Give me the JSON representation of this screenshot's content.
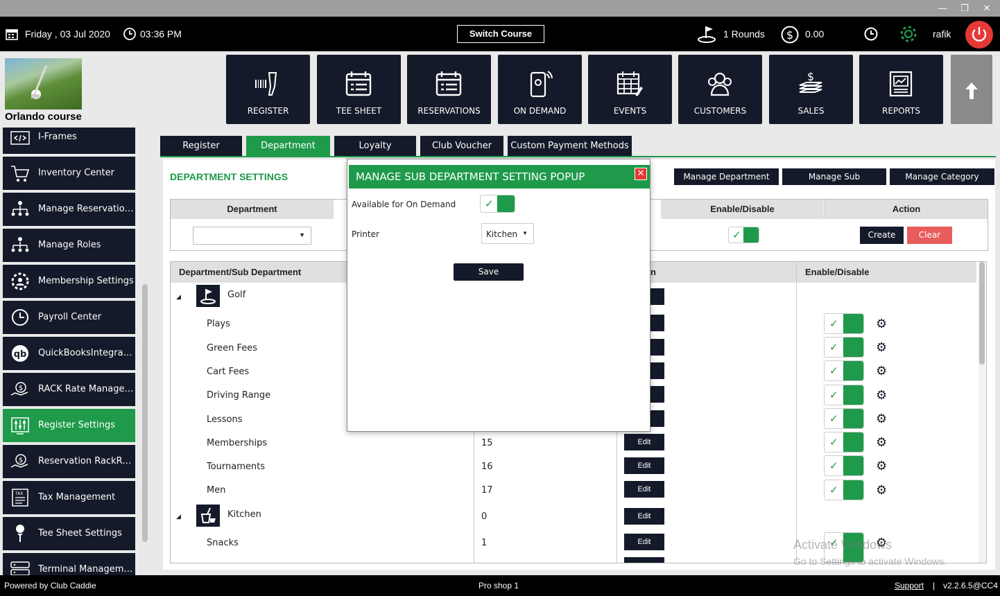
{
  "window": {
    "minimize": "—",
    "restore": "❐",
    "close": "✕"
  },
  "topbar": {
    "date": "Friday ,  03 Jul 2020",
    "time": "03:36 PM",
    "switch_course": "Switch Course",
    "rounds": "1 Rounds",
    "balance": "0.00",
    "user": "rafik"
  },
  "course": {
    "name": "Orlando course"
  },
  "nav_tiles": [
    {
      "label": "REGISTER"
    },
    {
      "label": "TEE SHEET"
    },
    {
      "label": "RESERVATIONS"
    },
    {
      "label": "ON DEMAND"
    },
    {
      "label": "EVENTS"
    },
    {
      "label": "CUSTOMERS"
    },
    {
      "label": "SALES"
    },
    {
      "label": "REPORTS"
    }
  ],
  "sidebar": {
    "items": [
      {
        "label": "I-Frames",
        "icon": "code-icon"
      },
      {
        "label": "Inventory Center",
        "icon": "cart-icon"
      },
      {
        "label": "Manage Reservation R...",
        "icon": "org-chart-icon"
      },
      {
        "label": "Manage Roles",
        "icon": "org-chart-icon"
      },
      {
        "label": "Membership Settings",
        "icon": "gear-user-icon"
      },
      {
        "label": "Payroll Center",
        "icon": "clock-icon"
      },
      {
        "label": "QuickBooksIntegration",
        "icon": "quickbooks-icon"
      },
      {
        "label": "RACK Rate Manageme...",
        "icon": "money-hand-icon"
      },
      {
        "label": "Register Settings",
        "icon": "sliders-icon",
        "active": true
      },
      {
        "label": "Reservation RackRate...",
        "icon": "money-hand-icon"
      },
      {
        "label": "Tax Management",
        "icon": "tax-icon"
      },
      {
        "label": "Tee Sheet Settings",
        "icon": "golf-tee-icon"
      },
      {
        "label": "Terminal Management",
        "icon": "server-icon"
      }
    ]
  },
  "tabs": [
    {
      "label": "Register"
    },
    {
      "label": "Department",
      "active": true
    },
    {
      "label": "Loyalty"
    },
    {
      "label": "Club Voucher Type"
    },
    {
      "label": "Custom Payment Methods"
    }
  ],
  "dept_settings": {
    "title": "DEPARTMENT SETTINGS",
    "buttons": {
      "manage_department": "Manage Department",
      "manage_sub_department": "Manage Sub Department",
      "manage_category": "Manage Category"
    },
    "form_headers": {
      "department": "Department",
      "enable_disable": "Enable/Disable",
      "action": "Action"
    },
    "create": "Create",
    "clear": "Clear",
    "department_value": ""
  },
  "table": {
    "headers": {
      "name": "Department/Sub Department",
      "mid": "n",
      "enable": "Enable/Disable"
    },
    "edit_label": "Edit",
    "groups": [
      {
        "name": "Golf",
        "icon": "golf-icon"
      },
      {
        "name": "Kitchen",
        "icon": "food-icon",
        "code": "0"
      }
    ],
    "rows": [
      {
        "name": "Plays"
      },
      {
        "name": "Green Fees"
      },
      {
        "name": "Cart Fees"
      },
      {
        "name": "Driving Range"
      },
      {
        "name": "Lessons"
      },
      {
        "name": "Memberships",
        "code": "15"
      },
      {
        "name": "Tournaments",
        "code": "16"
      },
      {
        "name": "Men",
        "code": "17"
      },
      {
        "name": "Snacks",
        "code": "1"
      }
    ]
  },
  "popup": {
    "title": "MANAGE SUB DEPARTMENT SETTING POPUP",
    "close": "✕",
    "on_demand_label": "Available for On Demand",
    "printer_label": "Printer",
    "printer_value": "Kitchen",
    "save": "Save"
  },
  "footer": {
    "powered": "Powered by Club Caddie",
    "location": "Pro shop 1",
    "support": "Support",
    "separator": "|",
    "version": "v2.2.6.5@CC4"
  },
  "watermark": {
    "line1": "Activate Windows",
    "line2": "Go to Settings to activate Windows."
  },
  "colors": {
    "accent": "#1e9a4a",
    "dark": "#141a29",
    "danger": "#e53935",
    "clear": "#e85c5c"
  }
}
